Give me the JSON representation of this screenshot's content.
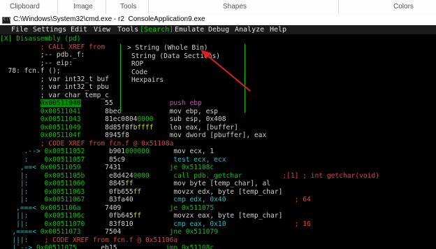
{
  "ribbon": {
    "groups": [
      "Clipboard",
      "Image",
      "Tools",
      "Shapes",
      "Colors"
    ]
  },
  "window": {
    "title": "C:\\Windows\\System32\\cmd.exe - r2  ConsoleApplication9.exe"
  },
  "menu": [
    "File",
    "Settings",
    "Edit",
    "View",
    "Tools",
    "[Search]",
    "Emulate",
    "Debug",
    "Analyze",
    "Help"
  ],
  "popup_items": [
    "> String (Whole Bin)",
    "String (Data Sections)",
    "ROP",
    "Code",
    "Hexpairs"
  ],
  "lines": [
    {
      "segs": [
        {
          "t": "[X] Disassembly (pd)",
          "c": "g"
        }
      ]
    },
    {
      "segs": [
        {
          "t": "          ; CALL XREF from",
          "c": "r"
        }
      ]
    },
    {
      "segs": [
        {
          "t": "          ;-- pdb._f:",
          "c": "w"
        }
      ]
    },
    {
      "segs": [
        {
          "t": "          ;-- eip:",
          "c": "w"
        }
      ]
    },
    {
      "segs": [
        {
          "t": "  78: fcn.f ();",
          "c": "w"
        }
      ]
    },
    {
      "segs": [
        {
          "t": "          ; var int32_t buf",
          "c": "w"
        }
      ]
    },
    {
      "segs": [
        {
          "t": "          ; var int32_t pbu",
          "c": "w"
        }
      ]
    },
    {
      "segs": [
        {
          "t": "          ; var char temp_c",
          "c": "w"
        }
      ]
    },
    {
      "segs": [
        {
          "t": "          ",
          "c": "w"
        },
        {
          "t": "0x00511040",
          "c": "hl"
        },
        {
          "t": "      55              ",
          "c": "w"
        },
        {
          "t": "push ebp",
          "c": "m"
        }
      ]
    },
    {
      "segs": [
        {
          "t": "          0x00511041",
          "c": "g"
        },
        {
          "t": "      8bec            mov ebp, esp",
          "c": "w"
        }
      ]
    },
    {
      "segs": [
        {
          "t": "          0x00511043",
          "c": "g"
        },
        {
          "t": "      81ec0804",
          "c": "w"
        },
        {
          "t": "0000",
          "c": "g"
        },
        {
          "t": "    sub esp, 0x408",
          "c": "w"
        }
      ]
    },
    {
      "segs": [
        {
          "t": "          0x00511049",
          "c": "g"
        },
        {
          "t": "      8d85f8fb",
          "c": "w"
        },
        {
          "t": "ffff",
          "c": "y"
        },
        {
          "t": "    lea eax, [buffer]",
          "c": "w"
        }
      ]
    },
    {
      "segs": [
        {
          "t": "          0x0051104f",
          "c": "g"
        },
        {
          "t": "      8945f8          mov dword [pbuffer], eax",
          "c": "w"
        }
      ]
    },
    {
      "segs": [
        {
          "t": "          ; CODE XREF from fcn.f @ 0x51108a",
          "c": "r"
        }
      ]
    },
    {
      "segs": [
        {
          "t": "      .--> ",
          "c": "c"
        },
        {
          "t": "0x00511052",
          "c": "g"
        },
        {
          "t": "      b901",
          "c": "w"
        },
        {
          "t": "000000",
          "c": "g"
        },
        {
          "t": "      mov ecx, 1",
          "c": "w"
        }
      ]
    },
    {
      "segs": [
        {
          "t": "      :    ",
          "c": "c"
        },
        {
          "t": "0x00511057",
          "c": "g"
        },
        {
          "t": "      85c9            ",
          "c": "w"
        },
        {
          "t": "test ecx, ecx",
          "c": "c"
        }
      ]
    },
    {
      "segs": [
        {
          "t": "     ,==< ",
          "c": "c"
        },
        {
          "t": "0x00511059",
          "c": "g"
        },
        {
          "t": "      7431            ",
          "c": "w"
        },
        {
          "t": "je 0x51108c",
          "c": "g"
        }
      ]
    },
    {
      "segs": [
        {
          "t": "     |:    ",
          "c": "c"
        },
        {
          "t": "0x0051105b",
          "c": "g"
        },
        {
          "t": "      e8d424",
          "c": "w"
        },
        {
          "t": "0000",
          "c": "g"
        },
        {
          "t": "      ",
          "c": "w"
        },
        {
          "t": "call pdb._getchar",
          "c": "g"
        },
        {
          "t": "          ;[1] ; int getchar(void)",
          "c": "r"
        }
      ]
    },
    {
      "segs": [
        {
          "t": "     |:    ",
          "c": "c"
        },
        {
          "t": "0x00511060",
          "c": "g"
        },
        {
          "t": "      8845",
          "c": "w"
        },
        {
          "t": "ff",
          "c": "y"
        },
        {
          "t": "          mov byte [temp_char], al",
          "c": "w"
        }
      ]
    },
    {
      "segs": [
        {
          "t": "     |:    ",
          "c": "c"
        },
        {
          "t": "0x00511063",
          "c": "g"
        },
        {
          "t": "      0fb655",
          "c": "w"
        },
        {
          "t": "ff",
          "c": "y"
        },
        {
          "t": "        movzx edx, byte [temp_char]",
          "c": "w"
        }
      ]
    },
    {
      "segs": [
        {
          "t": "     |:    ",
          "c": "c"
        },
        {
          "t": "0x00511067",
          "c": "g"
        },
        {
          "t": "      83fa40          ",
          "c": "w"
        },
        {
          "t": "cmp edx, 0x40",
          "c": "c"
        },
        {
          "t": "                 ; 64",
          "c": "r"
        }
      ]
    },
    {
      "segs": [
        {
          "t": "    ,===< ",
          "c": "c"
        },
        {
          "t": "0x0051106a",
          "c": "g"
        },
        {
          "t": "      7409            ",
          "c": "w"
        },
        {
          "t": "je 0x511075",
          "c": "g"
        }
      ]
    },
    {
      "segs": [
        {
          "t": "    ||:    ",
          "c": "c"
        },
        {
          "t": "0x0051106c",
          "c": "g"
        },
        {
          "t": "      0fb645",
          "c": "w"
        },
        {
          "t": "ff",
          "c": "y"
        },
        {
          "t": "        movzx eax, byte [temp_char]",
          "c": "w"
        }
      ]
    },
    {
      "segs": [
        {
          "t": "    ||:    ",
          "c": "c"
        },
        {
          "t": "0x00511070",
          "c": "g"
        },
        {
          "t": "      83f810          ",
          "c": "w"
        },
        {
          "t": "cmp eax, 0x10",
          "c": "c"
        },
        {
          "t": "                 ; 16",
          "c": "r"
        }
      ]
    },
    {
      "segs": [
        {
          "t": "   ,====< ",
          "c": "c"
        },
        {
          "t": "0x00511073",
          "c": "g"
        },
        {
          "t": "      7504            ",
          "c": "w"
        },
        {
          "t": "jne 0x511079",
          "c": "g"
        }
      ]
    },
    {
      "segs": [
        {
          "t": "   |||:    ",
          "c": "c"
        },
        {
          "t": "; CODE XREF from fcn.f @ 0x51106a",
          "c": "r"
        }
      ]
    },
    {
      "segs": [
        {
          "t": "   |`--> ",
          "c": "c"
        },
        {
          "t": "0x00511075",
          "c": "g"
        },
        {
          "t": "      eb15            ",
          "c": "w"
        },
        {
          "t": "jmp 0x51108c",
          "c": "g"
        }
      ]
    }
  ]
}
